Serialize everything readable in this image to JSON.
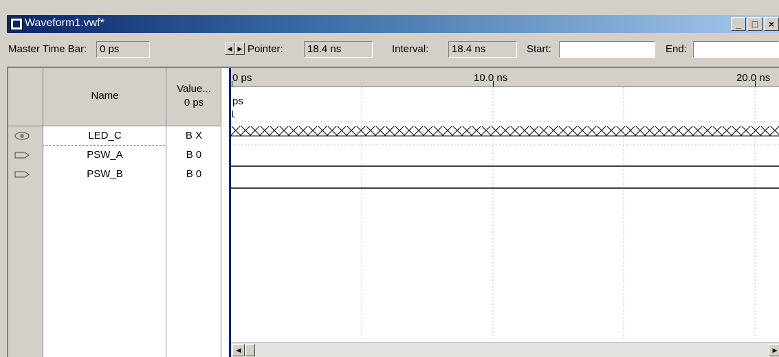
{
  "window": {
    "title": "Waveform1.vwf*",
    "buttons": {
      "minimize": "_",
      "maximize": "□",
      "close": "×"
    }
  },
  "toolbar": {
    "master_time_bar_label": "Master Time Bar:",
    "master_time_bar_value": "0 ps",
    "pointer_label": "Pointer:",
    "pointer_value": "18.4 ns",
    "interval_label": "Interval:",
    "interval_value": "18.4 ns",
    "start_label": "Start:",
    "start_value": "",
    "end_label": "End:",
    "end_value": ""
  },
  "columns": {
    "name_header": "Name",
    "value_header_1": "Value...",
    "value_header_2": "0 ps"
  },
  "signals": [
    {
      "name": "LED_C",
      "value": "B X",
      "icon": "output-pin-icon",
      "wave": "unknown"
    },
    {
      "name": "PSW_A",
      "value": "B 0",
      "icon": "input-pin-icon",
      "wave": "low"
    },
    {
      "name": "PSW_B",
      "value": "B 0",
      "icon": "input-pin-icon",
      "wave": "low"
    }
  ],
  "timeline": {
    "labels": [
      "0 ps",
      "10.0 ns",
      "20.0 ns"
    ],
    "marker_label": "ps"
  },
  "colors": {
    "selection": "#0a246a",
    "title_gradient_end": "#a6caf0"
  }
}
